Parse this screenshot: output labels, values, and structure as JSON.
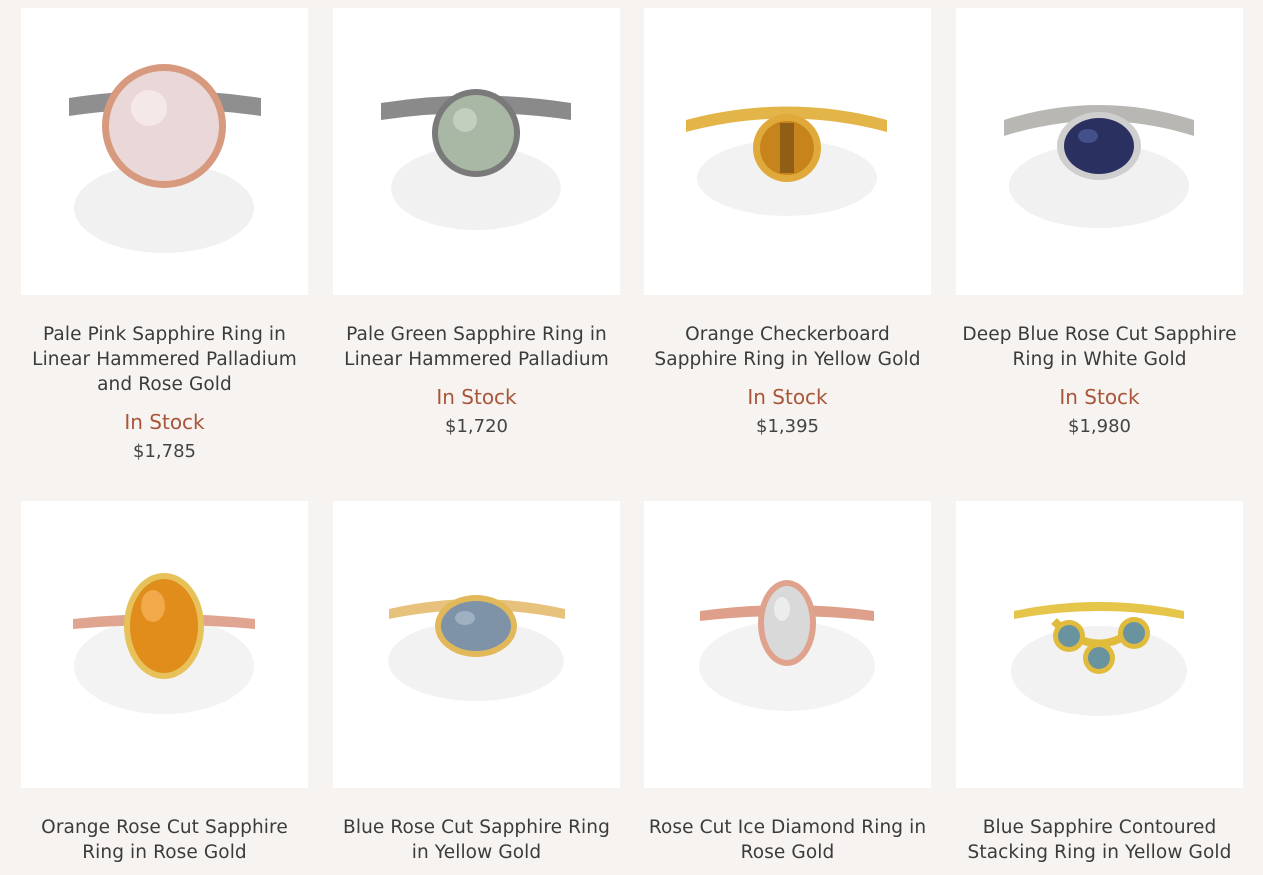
{
  "products": [
    {
      "title": "Pale Pink Sapphire Ring in Linear Hammered Palladium and Rose Gold",
      "stock": "In Stock",
      "price": "$1,785",
      "image": {
        "band": "#8f8f8f",
        "bezel": "#d89a7e",
        "stone": "#ead8d8",
        "shape": "round-large"
      }
    },
    {
      "title": "Pale Green Sapphire Ring in Linear Hammered Palladium",
      "stock": "In Stock",
      "price": "$1,720",
      "image": {
        "band": "#8a8a8a",
        "bezel": "#7a7a7a",
        "stone": "#a9b8a4",
        "shape": "round"
      }
    },
    {
      "title": "Orange Checkerboard Sapphire Ring in Yellow Gold",
      "stock": "In Stock",
      "price": "$1,395",
      "image": {
        "band": "#e3b548",
        "bezel": "#e0a93c",
        "stone": "#c7841c",
        "shape": "round-small"
      }
    },
    {
      "title": "Deep Blue Rose Cut Sapphire Ring in White Gold",
      "stock": "In Stock",
      "price": "$1,980",
      "image": {
        "band": "#b9b7b4",
        "bezel": "#cfcfcf",
        "stone": "#2a3160",
        "shape": "oval-h"
      }
    },
    {
      "title": "Orange Rose Cut Sapphire Ring in Rose Gold",
      "stock": "",
      "price": "",
      "image": {
        "band": "#e0a590",
        "bezel": "#e7c25a",
        "stone": "#e08d1c",
        "shape": "oval-v"
      }
    },
    {
      "title": "Blue Rose Cut Sapphire Ring in Yellow Gold",
      "stock": "",
      "price": "",
      "image": {
        "band": "#e6c27c",
        "bezel": "#e2b95a",
        "stone": "#7e92a8",
        "shape": "oval-h"
      }
    },
    {
      "title": "Rose Cut Ice Diamond Ring in Rose Gold",
      "stock": "",
      "price": "",
      "image": {
        "band": "#dea08a",
        "bezel": "#dfa28c",
        "stone": "#d9d9d9",
        "shape": "oval-tall"
      }
    },
    {
      "title": "Blue Sapphire Contoured Stacking Ring in Yellow Gold",
      "stock": "",
      "price": "",
      "image": {
        "band": "#e5c64a",
        "bezel": "#e0bb3c",
        "stone": "#6a93a0",
        "shape": "triple"
      }
    }
  ]
}
